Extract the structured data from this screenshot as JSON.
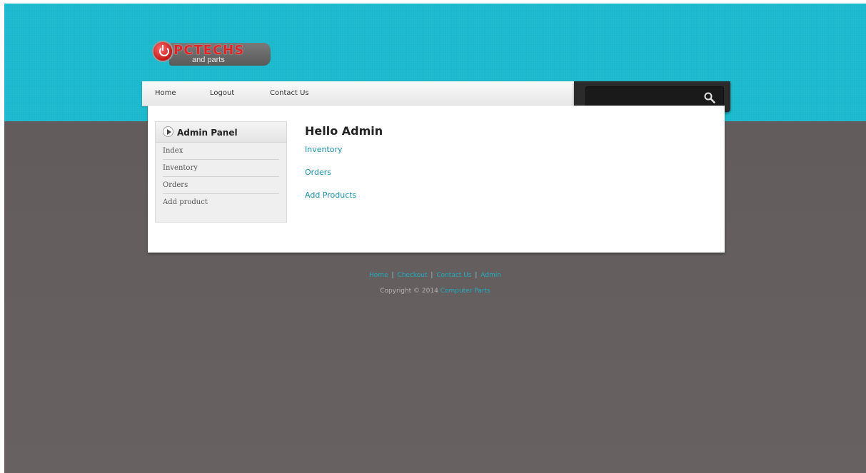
{
  "logo": {
    "text": "PCTECHS",
    "subtext": "and parts"
  },
  "nav": {
    "items": [
      "Home",
      "Logout",
      "Contact Us"
    ]
  },
  "search": {
    "placeholder": "",
    "icon": "search-icon"
  },
  "sidebar": {
    "title": "Admin Panel",
    "items": [
      "Index",
      "Inventory",
      "Orders",
      "Add product"
    ]
  },
  "main": {
    "heading": "Hello Admin",
    "links": [
      "Inventory",
      "Orders",
      "Add Products"
    ]
  },
  "footer": {
    "links": [
      "Home",
      "Checkout",
      "Contact Us",
      "Admin"
    ],
    "copyright": "Copyright © 2014",
    "brand_link": "Computer Parts"
  },
  "colors": {
    "header_band": "#1ab8cc",
    "page_background": "#625c5c",
    "link": "#1a8fa6"
  }
}
